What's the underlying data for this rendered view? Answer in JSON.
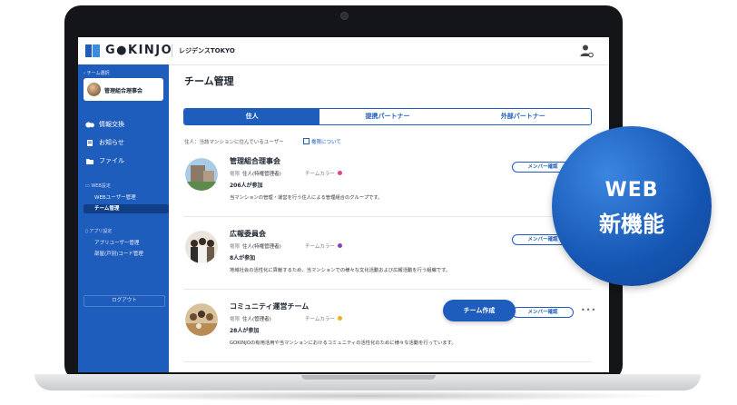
{
  "brand": {
    "logo_text": "G●KINJO",
    "building_name": "レジデンスTOKYO"
  },
  "sidebar": {
    "back_label": "‹ チーム選択",
    "org_name": "管理組合理事会",
    "items": [
      {
        "label": "情報交換",
        "icon": "chat-icon"
      },
      {
        "label": "お知らせ",
        "icon": "notice-icon"
      },
      {
        "label": "ファイル",
        "icon": "folder-icon"
      }
    ],
    "web_section": {
      "label": "WEB設定",
      "items": [
        "WEBユーザー管理",
        "チーム管理"
      ]
    },
    "app_section": {
      "label": "アプリ設定",
      "items": [
        "アプリユーザー管理",
        "部屋(戸別)コード管理"
      ]
    },
    "logout_label": "ログアウト"
  },
  "main": {
    "title": "チーム管理",
    "tabs": [
      {
        "label": "住人",
        "active": true
      },
      {
        "label": "提携パートナー",
        "active": false
      },
      {
        "label": "外部パートナー",
        "active": false
      }
    ],
    "description": "住人：当該マンションに住んでいるユーザー",
    "authority_link": "権限について",
    "member_button": "メンバー確認",
    "create_button": "チーム作成",
    "teams": [
      {
        "name": "管理組合理事会",
        "role_key": "権限",
        "role": "住人(特権管理者)",
        "color_label": "チームカラー",
        "color": "#e0458c",
        "members": "206人が参加",
        "description": "当マンションの管理・運営を行う住人による管理組合のグループです。"
      },
      {
        "name": "広報委員会",
        "role_key": "権限",
        "role": "住人(特権管理者)",
        "color_label": "チームカラー",
        "color": "#8d3fbf",
        "members": "8人が参加",
        "description": "地域社会の活性化に貢献するため、当マンションでの様々な文化活動および広報活動を行う組織です。"
      },
      {
        "name": "コミュニティ運営チーム",
        "role_key": "権限",
        "role": "住人(管理者)",
        "color_label": "チームカラー",
        "color": "#e8b21c",
        "members": "28人が参加",
        "description": "GOKINJOの有用活用や当マンションにおけるコミュニティの活性化のために様々な活動を行っています。"
      }
    ]
  },
  "badge": {
    "line1": "WEB",
    "line2": "新機能"
  },
  "colors": {
    "primary": "#1f5dbd",
    "sidebar": "#1f5dbd",
    "badge": "#1556b3"
  }
}
